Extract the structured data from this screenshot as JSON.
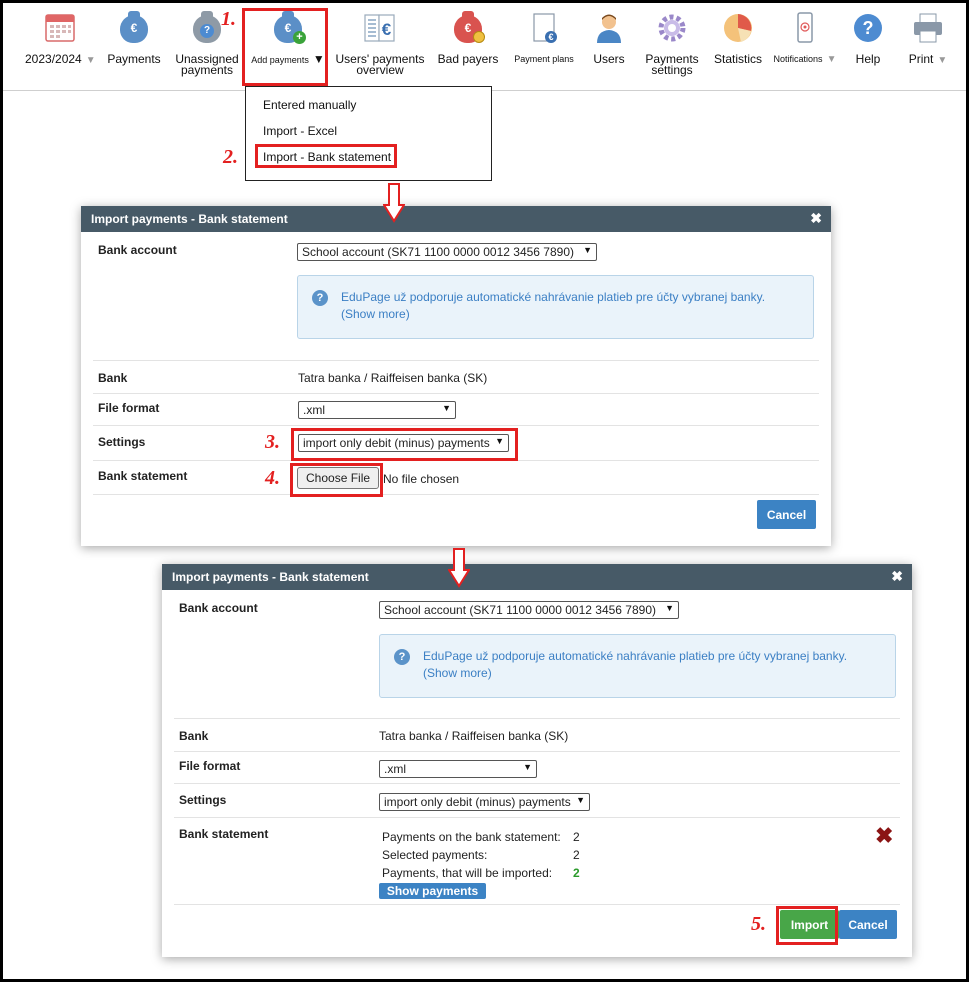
{
  "toolbar": {
    "items": [
      {
        "label": "2023/2024",
        "icon": "calendar-icon"
      },
      {
        "label": "Payments",
        "icon": "euro-bag-icon"
      },
      {
        "label": "Unassigned payments",
        "icon": "question-bag-icon"
      },
      {
        "label": "Add payments",
        "icon": "add-bag-icon"
      },
      {
        "label": "Users' payments overview",
        "icon": "ledger-icon"
      },
      {
        "label": "Bad payers",
        "icon": "red-bag-icon"
      },
      {
        "label": "Payment plans",
        "icon": "document-euro-icon"
      },
      {
        "label": "Users",
        "icon": "user-icon"
      },
      {
        "label": "Payments settings",
        "icon": "gear-icon"
      },
      {
        "label": "Statistics",
        "icon": "pie-chart-icon"
      },
      {
        "label": "Notifications",
        "icon": "phone-icon"
      },
      {
        "label": "Help",
        "icon": "help-icon"
      },
      {
        "label": "Print",
        "icon": "printer-icon"
      }
    ],
    "active_item": "Users"
  },
  "add_payments_menu": {
    "items": [
      "Entered manually",
      "Import - Excel",
      "Import - Bank statement"
    ]
  },
  "steps": [
    "1.",
    "2.",
    "3.",
    "4.",
    "5."
  ],
  "dialog1": {
    "title": "Import payments - Bank statement",
    "close_symbol": "✖",
    "bank_account_label": "Bank account",
    "bank_account_value": "School account (SK71 1100 0000 0012 3456 7890)",
    "info_text": "EduPage už podporuje automatické nahrávanie platieb pre účty vybranej banky.",
    "info_link": "(Show more)",
    "bank_label": "Bank",
    "bank_value": "Tatra banka / Raiffeisen banka (SK)",
    "file_format_label": "File format",
    "file_format_value": ".xml",
    "settings_label": "Settings",
    "settings_value": "import only debit (minus) payments",
    "bank_statement_label": "Bank statement",
    "choose_file_label": "Choose File",
    "no_file_text": "No file chosen",
    "cancel_label": "Cancel"
  },
  "dialog2": {
    "title": "Import payments - Bank statement",
    "close_symbol": "✖",
    "bank_account_label": "Bank account",
    "bank_account_value": "School account (SK71 1100 0000 0012 3456 7890)",
    "info_text": "EduPage už podporuje automatické nahrávanie platieb pre účty vybranej banky.",
    "info_link": "(Show more)",
    "bank_label": "Bank",
    "bank_value": "Tatra banka / Raiffeisen banka (SK)",
    "file_format_label": "File format",
    "file_format_value": ".xml",
    "settings_label": "Settings",
    "settings_value": "import only debit (minus) payments",
    "bank_statement_label": "Bank statement",
    "payments_on_statement_label": "Payments on the bank statement:",
    "payments_on_statement_value": "2",
    "selected_payments_label": "Selected payments:",
    "selected_payments_value": "2",
    "to_import_label": "Payments, that will be imported:",
    "to_import_value": "2",
    "show_payments_label": "Show payments",
    "import_label": "Import",
    "cancel_label": "Cancel"
  },
  "colors": {
    "header_bg": "#475a67",
    "button_blue": "#3c83c4",
    "button_green": "#48a648",
    "highlight_red": "#e32020",
    "active_tab": "#fdf0b8"
  }
}
